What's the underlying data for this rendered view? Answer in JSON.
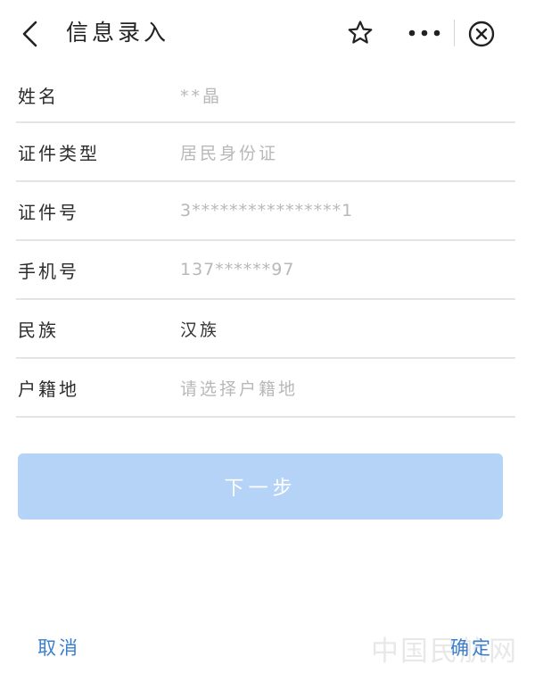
{
  "header": {
    "title": "信息录入",
    "icons": [
      "back-icon",
      "star-icon",
      "more-icon",
      "close-icon"
    ]
  },
  "form": {
    "rows": [
      {
        "label": "姓名",
        "value": "**晶"
      },
      {
        "label": "证件类型",
        "value": "居民身份证"
      },
      {
        "label": "证件号",
        "value": "3****************1"
      },
      {
        "label": "手机号",
        "value": "137******97"
      },
      {
        "label": "民族",
        "value": "汉族"
      },
      {
        "label": "户籍地",
        "placeholder": "请选择户籍地"
      }
    ]
  },
  "next_button": {
    "label": "下一步"
  },
  "bottom": {
    "cancel_label": "取消",
    "confirm_label": "确定"
  },
  "watermark": "中国民航网",
  "colors": {
    "accent": "#3a7fd0",
    "button_disabled": "#b5d3f6",
    "placeholder": "#b8b8b8",
    "divider": "#e4e4e4"
  }
}
